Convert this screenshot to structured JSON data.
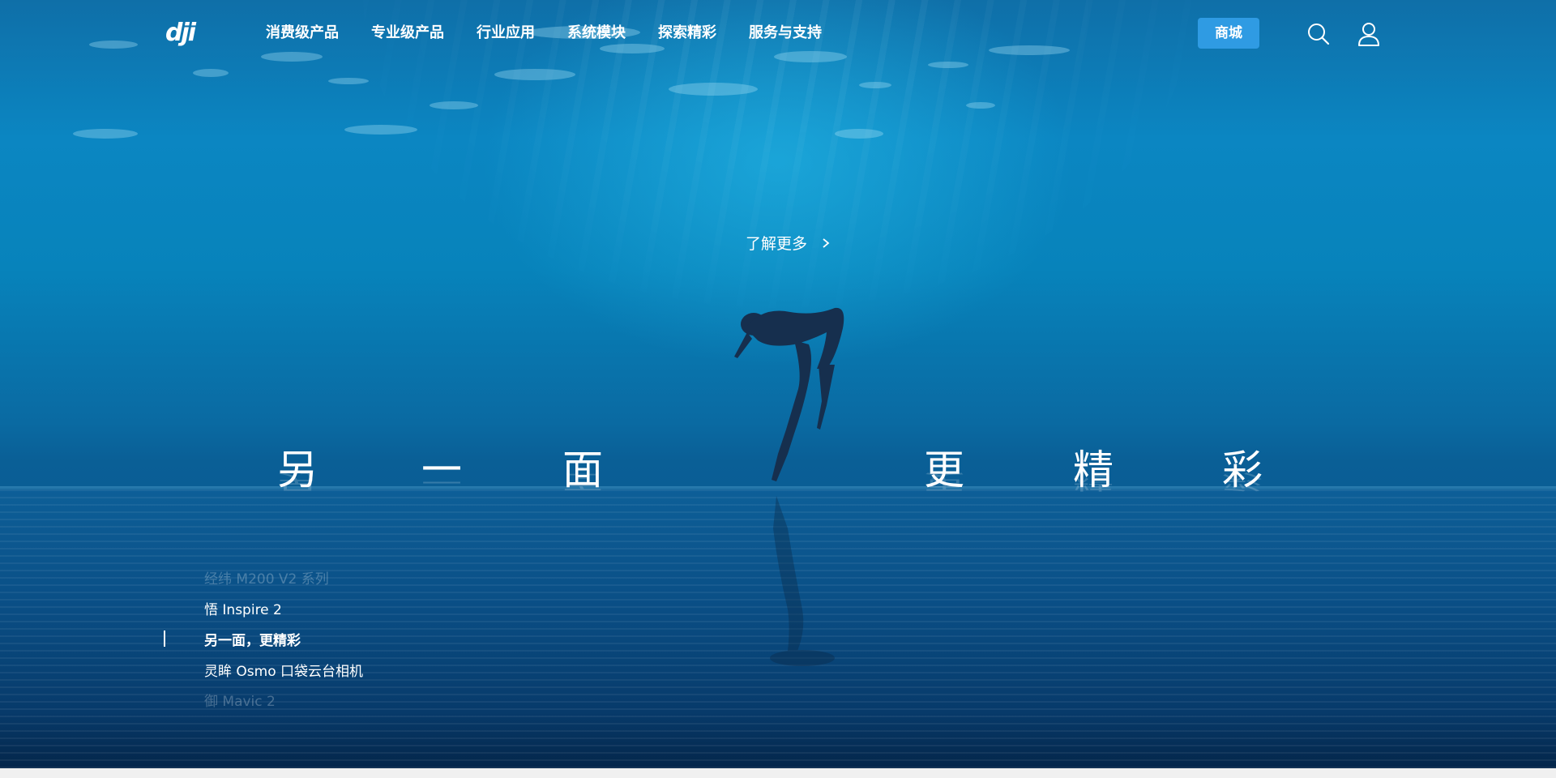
{
  "header": {
    "logo_text": "dji",
    "nav": [
      "消费级产品",
      "专业级产品",
      "行业应用",
      "系统模块",
      "探索精彩",
      "服务与支持"
    ],
    "store_label": "商城"
  },
  "hero": {
    "learn_more": "了解更多",
    "headline_chars": [
      "另",
      "一",
      "面",
      "更",
      "精",
      "彩"
    ]
  },
  "slides": {
    "items": [
      "经纬 M200 V2 系列",
      "悟 Inspire 2",
      "另一面，更精彩",
      "灵眸 Osmo 口袋云台相机",
      "御 Mavic 2"
    ],
    "active_index": 2
  },
  "colors": {
    "store_button": "#2f9be3",
    "water_dark": "#072f59",
    "water_light": "#0b86c2"
  },
  "icons": [
    "dji-logo",
    "search-icon",
    "user-icon",
    "chevron-right-icon"
  ]
}
